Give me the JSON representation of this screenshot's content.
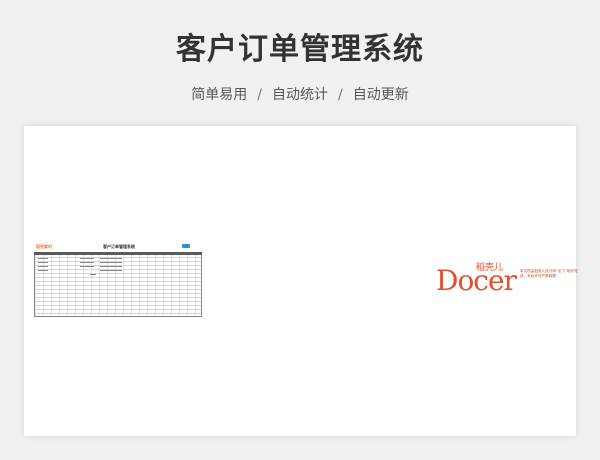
{
  "page": {
    "title": "客户订单管理系统",
    "subtitle_parts": [
      "简单易用",
      "自动统计",
      "自动更新"
    ],
    "separator": "/"
  },
  "preview": {
    "sheet_logo": "稻壳素材",
    "sheet_title": "客户订单管理系统",
    "brand_word": "Docer",
    "brand_cn": "稻壳儿",
    "brand_desc": "本文档由稻壳儿设计师“龙飞”制作完成，未经许可严禁转载"
  },
  "colors": {
    "brand": "#e2512f",
    "accent_blue": "#2a8fd6",
    "background": "#f1f1f1"
  }
}
